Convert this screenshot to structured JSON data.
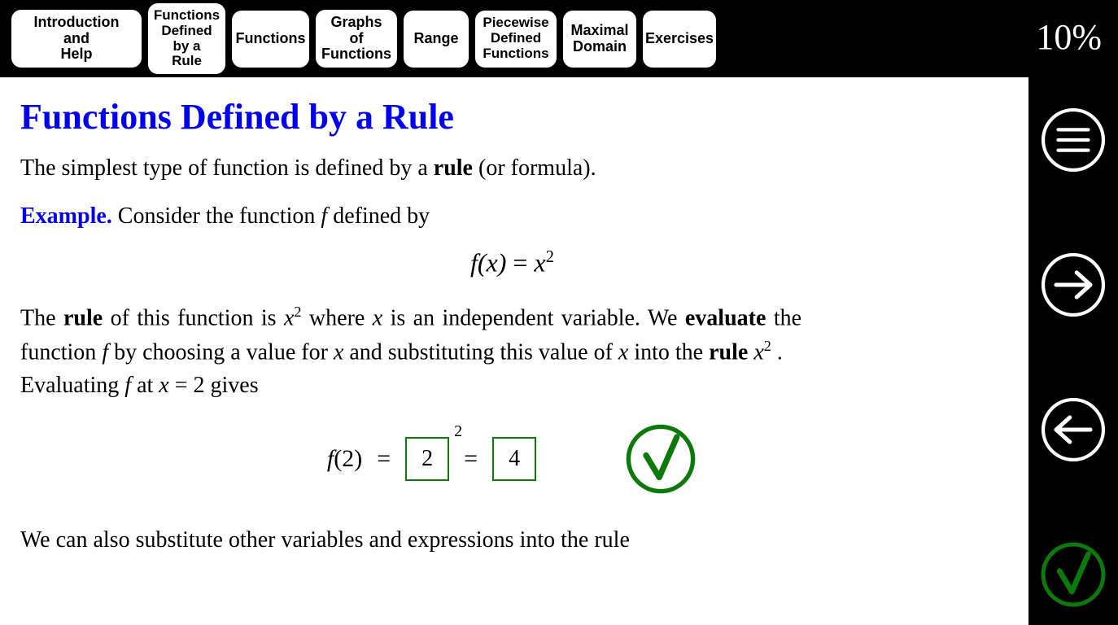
{
  "nav": {
    "tabs": [
      "Introduction\nand\nHelp",
      "Functions\nDefined\nby a\nRule",
      "Functions",
      "Graphs\nof\nFunctions",
      "Range",
      "Piecewise\nDefined\nFunctions",
      "Maximal\nDomain",
      "Exercises"
    ],
    "progress": "10%"
  },
  "page": {
    "title": "Functions Defined by a Rule",
    "intro_pre": "The simplest type of function is defined by a ",
    "intro_bold": "rule",
    "intro_post": " (or formula).",
    "example_label": "Example.",
    "example_text": " Consider the function ",
    "example_fdef": " defined by",
    "eq1_lhs": "f",
    "eq1_paren_x": "(x)",
    "eq1_eq": " = ",
    "eq1_rhs_base": "x",
    "eq1_rhs_exp": "2",
    "p2_a": "The ",
    "p2_rule": "rule",
    "p2_b": " of this function is ",
    "p2_x2_base": "x",
    "p2_x2_exp": "2",
    "p2_c": " where ",
    "p2_x": "x",
    "p2_d": " is an independent variable.  We ",
    "p2_eval": "evaluate",
    "p2_e": " the function ",
    "p2_f": "f",
    "p2_g": " by choosing a value for ",
    "p2_x2var": "x",
    "p2_h": " and substituting this value of ",
    "p2_x3var": "x",
    "p2_i": " into the ",
    "p2_rule2": "rule",
    "p2_j_base": "x",
    "p2_j_exp": "2",
    "p2_k": " .",
    "p3_a": "Evaluating ",
    "p3_f": "f",
    "p3_b": " at ",
    "p3_x": "x",
    "p3_c": " = 2 gives",
    "ans_lhs": "f",
    "ans_arg": "(2)",
    "ans_eq1": "=",
    "ans_box1": "2",
    "ans_box1_exp": "2",
    "ans_eq2": "=",
    "ans_box2": "4",
    "p4": "We can also substitute other variables and expressions into the rule"
  },
  "sidebar": {
    "menu": "menu",
    "next": "next",
    "prev": "prev",
    "check": "check"
  }
}
